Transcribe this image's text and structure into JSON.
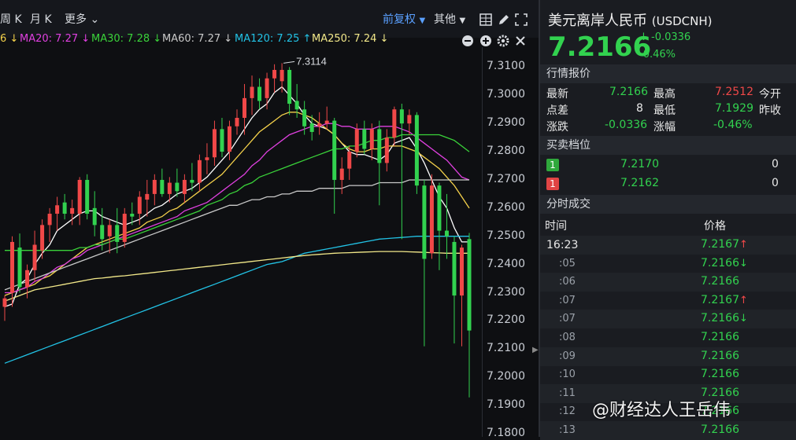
{
  "toolbar": {
    "period_week": "周 K",
    "period_month": "月 K",
    "more": "更多",
    "adjust": "前复权",
    "other": "其他"
  },
  "ma_legend": [
    {
      "text": "6 ↓",
      "color": "#f5d24b"
    },
    {
      "text": "MA20: 7.27 ↓",
      "color": "#e040e0"
    },
    {
      "text": "MA30: 7.28 ↓",
      "color": "#3ad33a"
    },
    {
      "text": "MA60: 7.27 ↓",
      "color": "#c9c9c9"
    },
    {
      "text": "MA120: 7.25 ↑",
      "color": "#22c3e6"
    },
    {
      "text": "MA250: 7.24 ↓",
      "color": "#f3e98a"
    }
  ],
  "chart_data": {
    "type": "candlestick",
    "annotation_high": "7.3114",
    "y_ticks": [
      "7.3100",
      "7.3000",
      "7.2900",
      "7.2800",
      "7.2700",
      "7.2600",
      "7.2500",
      "7.2400",
      "7.2300",
      "7.2200",
      "7.2100",
      "7.2000",
      "7.1900",
      "7.1800"
    ],
    "ylim": [
      7.18,
      7.3115
    ],
    "up_color": "#f04848",
    "down_color": "#32d24f",
    "candles": [
      {
        "o": 7.225,
        "h": 7.229,
        "l": 7.22,
        "c": 7.228
      },
      {
        "o": 7.23,
        "h": 7.25,
        "l": 7.225,
        "c": 7.248
      },
      {
        "o": 7.246,
        "h": 7.251,
        "l": 7.23,
        "c": 7.232
      },
      {
        "o": 7.232,
        "h": 7.24,
        "l": 7.228,
        "c": 7.238
      },
      {
        "o": 7.238,
        "h": 7.252,
        "l": 7.234,
        "c": 7.247
      },
      {
        "o": 7.245,
        "h": 7.256,
        "l": 7.242,
        "c": 7.254
      },
      {
        "o": 7.254,
        "h": 7.26,
        "l": 7.248,
        "c": 7.258
      },
      {
        "o": 7.258,
        "h": 7.264,
        "l": 7.252,
        "c": 7.261
      },
      {
        "o": 7.262,
        "h": 7.265,
        "l": 7.256,
        "c": 7.258
      },
      {
        "o": 7.258,
        "h": 7.263,
        "l": 7.254,
        "c": 7.26
      },
      {
        "o": 7.258,
        "h": 7.271,
        "l": 7.254,
        "c": 7.27
      },
      {
        "o": 7.27,
        "h": 7.272,
        "l": 7.256,
        "c": 7.258
      },
      {
        "o": 7.26,
        "h": 7.266,
        "l": 7.25,
        "c": 7.254
      },
      {
        "o": 7.254,
        "h": 7.26,
        "l": 7.245,
        "c": 7.249
      },
      {
        "o": 7.25,
        "h": 7.256,
        "l": 7.244,
        "c": 7.254
      },
      {
        "o": 7.254,
        "h": 7.26,
        "l": 7.244,
        "c": 7.248
      },
      {
        "o": 7.248,
        "h": 7.26,
        "l": 7.246,
        "c": 7.258
      },
      {
        "o": 7.258,
        "h": 7.262,
        "l": 7.254,
        "c": 7.257
      },
      {
        "o": 7.258,
        "h": 7.266,
        "l": 7.254,
        "c": 7.264
      },
      {
        "o": 7.263,
        "h": 7.27,
        "l": 7.257,
        "c": 7.265
      },
      {
        "o": 7.265,
        "h": 7.272,
        "l": 7.261,
        "c": 7.27
      },
      {
        "o": 7.27,
        "h": 7.274,
        "l": 7.264,
        "c": 7.265
      },
      {
        "o": 7.265,
        "h": 7.271,
        "l": 7.262,
        "c": 7.269
      },
      {
        "o": 7.269,
        "h": 7.274,
        "l": 7.264,
        "c": 7.266
      },
      {
        "o": 7.265,
        "h": 7.272,
        "l": 7.262,
        "c": 7.27
      },
      {
        "o": 7.27,
        "h": 7.276,
        "l": 7.266,
        "c": 7.269
      },
      {
        "o": 7.269,
        "h": 7.279,
        "l": 7.266,
        "c": 7.277
      },
      {
        "o": 7.277,
        "h": 7.283,
        "l": 7.272,
        "c": 7.278
      },
      {
        "o": 7.278,
        "h": 7.291,
        "l": 7.275,
        "c": 7.288
      },
      {
        "o": 7.288,
        "h": 7.292,
        "l": 7.278,
        "c": 7.28
      },
      {
        "o": 7.28,
        "h": 7.291,
        "l": 7.277,
        "c": 7.289
      },
      {
        "o": 7.289,
        "h": 7.295,
        "l": 7.286,
        "c": 7.292
      },
      {
        "o": 7.292,
        "h": 7.304,
        "l": 7.286,
        "c": 7.299
      },
      {
        "o": 7.299,
        "h": 7.307,
        "l": 7.293,
        "c": 7.303
      },
      {
        "o": 7.303,
        "h": 7.306,
        "l": 7.295,
        "c": 7.298
      },
      {
        "o": 7.299,
        "h": 7.308,
        "l": 7.295,
        "c": 7.306
      },
      {
        "o": 7.306,
        "h": 7.311,
        "l": 7.301,
        "c": 7.309
      },
      {
        "o": 7.305,
        "h": 7.3114,
        "l": 7.301,
        "c": 7.309
      },
      {
        "o": 7.309,
        "h": 7.31,
        "l": 7.293,
        "c": 7.297
      },
      {
        "o": 7.298,
        "h": 7.304,
        "l": 7.292,
        "c": 7.295
      },
      {
        "o": 7.295,
        "h": 7.298,
        "l": 7.286,
        "c": 7.289
      },
      {
        "o": 7.29,
        "h": 7.293,
        "l": 7.284,
        "c": 7.287
      },
      {
        "o": 7.289,
        "h": 7.294,
        "l": 7.286,
        "c": 7.29
      },
      {
        "o": 7.29,
        "h": 7.296,
        "l": 7.288,
        "c": 7.291
      },
      {
        "o": 7.291,
        "h": 7.292,
        "l": 7.258,
        "c": 7.27
      },
      {
        "o": 7.27,
        "h": 7.278,
        "l": 7.265,
        "c": 7.274
      },
      {
        "o": 7.274,
        "h": 7.282,
        "l": 7.27,
        "c": 7.28
      },
      {
        "o": 7.28,
        "h": 7.29,
        "l": 7.278,
        "c": 7.288
      },
      {
        "o": 7.288,
        "h": 7.291,
        "l": 7.279,
        "c": 7.281
      },
      {
        "o": 7.281,
        "h": 7.29,
        "l": 7.277,
        "c": 7.288
      },
      {
        "o": 7.288,
        "h": 7.291,
        "l": 7.261,
        "c": 7.276
      },
      {
        "o": 7.276,
        "h": 7.288,
        "l": 7.273,
        "c": 7.285
      },
      {
        "o": 7.285,
        "h": 7.296,
        "l": 7.282,
        "c": 7.295
      },
      {
        "o": 7.295,
        "h": 7.297,
        "l": 7.249,
        "c": 7.29
      },
      {
        "o": 7.29,
        "h": 7.295,
        "l": 7.286,
        "c": 7.293
      },
      {
        "o": 7.293,
        "h": 7.294,
        "l": 7.265,
        "c": 7.268
      },
      {
        "o": 7.268,
        "h": 7.27,
        "l": 7.211,
        "c": 7.242
      },
      {
        "o": 7.244,
        "h": 7.272,
        "l": 7.242,
        "c": 7.268
      },
      {
        "o": 7.268,
        "h": 7.269,
        "l": 7.238,
        "c": 7.252
      },
      {
        "o": 7.252,
        "h": 7.265,
        "l": 7.242,
        "c": 7.25
      },
      {
        "o": 7.248,
        "h": 7.25,
        "l": 7.212,
        "c": 7.229
      },
      {
        "o": 7.229,
        "h": 7.247,
        "l": 7.211,
        "c": 7.246
      },
      {
        "o": 7.249,
        "h": 7.2512,
        "l": 7.1929,
        "c": 7.2166
      }
    ],
    "ma_series": [
      {
        "color": "#ffffff",
        "values": [
          7.225,
          7.226,
          7.233,
          7.235,
          7.24,
          7.244,
          7.247,
          7.252,
          7.254,
          7.256,
          7.258,
          7.259,
          7.259,
          7.257,
          7.256,
          7.255,
          7.254,
          7.255,
          7.256,
          7.258,
          7.26,
          7.261,
          7.263,
          7.265,
          7.266,
          7.267,
          7.269,
          7.271,
          7.274,
          7.277,
          7.28,
          7.284,
          7.288,
          7.292,
          7.295,
          7.297,
          7.301,
          7.303,
          7.3,
          7.297,
          7.293,
          7.29,
          7.289,
          7.288,
          7.286,
          7.283,
          7.28,
          7.279,
          7.279,
          7.278,
          7.277,
          7.279,
          7.283,
          7.284,
          7.285,
          7.281,
          7.276,
          7.27,
          7.264,
          7.26,
          7.253,
          7.248,
          7.248
        ]
      },
      {
        "color": "#f5d24b",
        "values": [
          7.229,
          7.23,
          7.231,
          7.232,
          7.233,
          7.235,
          7.236,
          7.238,
          7.24,
          7.242,
          7.244,
          7.246,
          7.247,
          7.248,
          7.249,
          7.25,
          7.251,
          7.252,
          7.253,
          7.255,
          7.256,
          7.257,
          7.259,
          7.26,
          7.262,
          7.264,
          7.266,
          7.268,
          7.27,
          7.272,
          7.275,
          7.278,
          7.281,
          7.284,
          7.287,
          7.289,
          7.291,
          7.293,
          7.294,
          7.294,
          7.293,
          7.292,
          7.29,
          7.288,
          7.286,
          7.283,
          7.281,
          7.28,
          7.28,
          7.281,
          7.281,
          7.282,
          7.282,
          7.282,
          7.281,
          7.28,
          7.278,
          7.276,
          7.274,
          7.271,
          7.268,
          7.264,
          7.26
        ]
      },
      {
        "color": "#e040e0",
        "values": [
          7.23,
          7.23,
          7.231,
          7.232,
          7.234,
          7.235,
          7.237,
          7.239,
          7.24,
          7.242,
          7.243,
          7.245,
          7.246,
          7.247,
          7.248,
          7.249,
          7.25,
          7.251,
          7.252,
          7.253,
          7.254,
          7.255,
          7.256,
          7.257,
          7.259,
          7.26,
          7.261,
          7.262,
          7.264,
          7.266,
          7.268,
          7.27,
          7.272,
          7.275,
          7.277,
          7.28,
          7.282,
          7.284,
          7.286,
          7.287,
          7.288,
          7.289,
          7.289,
          7.29,
          7.29,
          7.289,
          7.289,
          7.288,
          7.288,
          7.288,
          7.289,
          7.289,
          7.289,
          7.288,
          7.287,
          7.285,
          7.283,
          7.281,
          7.279,
          7.277,
          7.274,
          7.271,
          7.27
        ]
      },
      {
        "color": "#3ad33a",
        "values": [
          7.245,
          7.245,
          7.245,
          7.245,
          7.245,
          7.245,
          7.245,
          7.245,
          7.245,
          7.245,
          7.246,
          7.246,
          7.247,
          7.247,
          7.248,
          7.249,
          7.249,
          7.25,
          7.251,
          7.252,
          7.253,
          7.254,
          7.255,
          7.256,
          7.257,
          7.258,
          7.259,
          7.261,
          7.262,
          7.263,
          7.265,
          7.266,
          7.268,
          7.269,
          7.271,
          7.272,
          7.273,
          7.274,
          7.275,
          7.276,
          7.277,
          7.278,
          7.279,
          7.28,
          7.281,
          7.281,
          7.282,
          7.282,
          7.283,
          7.284,
          7.284,
          7.285,
          7.285,
          7.286,
          7.286,
          7.286,
          7.286,
          7.286,
          7.286,
          7.285,
          7.284,
          7.282,
          7.28
        ]
      },
      {
        "color": "#c9c9c9",
        "values": [
          7.231,
          7.232,
          7.233,
          7.234,
          7.235,
          7.236,
          7.237,
          7.238,
          7.239,
          7.24,
          7.241,
          7.242,
          7.243,
          7.244,
          7.245,
          7.246,
          7.247,
          7.248,
          7.249,
          7.25,
          7.251,
          7.252,
          7.253,
          7.254,
          7.255,
          7.256,
          7.257,
          7.258,
          7.259,
          7.26,
          7.261,
          7.261,
          7.262,
          7.263,
          7.263,
          7.264,
          7.264,
          7.265,
          7.265,
          7.266,
          7.266,
          7.266,
          7.267,
          7.267,
          7.267,
          7.267,
          7.268,
          7.268,
          7.268,
          7.268,
          7.269,
          7.269,
          7.269,
          7.269,
          7.27,
          7.27,
          7.27,
          7.27,
          7.27,
          7.27,
          7.27,
          7.27,
          7.27
        ]
      },
      {
        "color": "#22c3e6",
        "values": [
          7.205,
          7.206,
          7.207,
          7.208,
          7.209,
          7.21,
          7.211,
          7.212,
          7.213,
          7.214,
          7.215,
          7.216,
          7.217,
          7.218,
          7.219,
          7.22,
          7.221,
          7.222,
          7.223,
          7.224,
          7.225,
          7.226,
          7.227,
          7.228,
          7.229,
          7.23,
          7.231,
          7.232,
          7.233,
          7.234,
          7.235,
          7.236,
          7.237,
          7.238,
          7.239,
          7.24,
          7.2405,
          7.241,
          7.242,
          7.243,
          7.244,
          7.2445,
          7.245,
          7.2455,
          7.246,
          7.2465,
          7.247,
          7.2475,
          7.248,
          7.2485,
          7.249,
          7.2492,
          7.2494,
          7.2496,
          7.2498,
          7.25,
          7.25,
          7.25,
          7.25,
          7.25,
          7.25,
          7.25,
          7.25
        ]
      },
      {
        "color": "#f3e98a",
        "values": [
          7.227,
          7.228,
          7.229,
          7.23,
          7.231,
          7.2315,
          7.232,
          7.2325,
          7.233,
          7.2335,
          7.234,
          7.2345,
          7.235,
          7.2352,
          7.2355,
          7.2358,
          7.236,
          7.2363,
          7.2366,
          7.2369,
          7.2372,
          7.2375,
          7.2378,
          7.2381,
          7.2384,
          7.2387,
          7.239,
          7.2393,
          7.2396,
          7.2399,
          7.2402,
          7.2405,
          7.2408,
          7.2411,
          7.2414,
          7.2417,
          7.242,
          7.2423,
          7.2426,
          7.2429,
          7.2432,
          7.2434,
          7.2436,
          7.2438,
          7.244,
          7.2441,
          7.2442,
          7.2443,
          7.2444,
          7.2445,
          7.2446,
          7.2446,
          7.2446,
          7.2446,
          7.2445,
          7.2444,
          7.2443,
          7.2442,
          7.2441,
          7.244,
          7.244,
          7.244,
          7.244
        ]
      }
    ]
  },
  "quote": {
    "title": "美元离岸人民币",
    "code": "(USDCNH)",
    "price": "7.2166",
    "change": "↓ -0.0336",
    "change_pct": "-0.46%",
    "section_quote": "行情报价",
    "rows": {
      "latest_lbl": "最新",
      "latest_val": "7.2166",
      "high_lbl": "最高",
      "high_val": "7.2512",
      "open_lbl": "今开",
      "spread_lbl": "点差",
      "spread_val": "8",
      "low_lbl": "最低",
      "low_val": "7.1929",
      "prev_lbl": "昨收",
      "chg_lbl": "涨跌",
      "chg_val": "-0.0336",
      "pct_lbl": "涨幅",
      "pct_val": "-0.46%"
    },
    "section_book": "买卖档位",
    "book": [
      {
        "badge": "1",
        "badge_color": "#2fa83c",
        "price": "7.2170",
        "qty": "0"
      },
      {
        "badge": "1",
        "badge_color": "#e04444",
        "price": "7.2162",
        "qty": "0"
      }
    ],
    "section_ticks": "分时成交",
    "tick_head_time": "时间",
    "tick_head_price": "价格",
    "ticks": [
      {
        "time": "16:23",
        "price": "7.2167",
        "arrow": "↑"
      },
      {
        "time": ":05",
        "price": "7.2166",
        "arrow": "↓"
      },
      {
        "time": ":06",
        "price": "7.2166",
        "arrow": ""
      },
      {
        "time": ":07",
        "price": "7.2167",
        "arrow": "↑"
      },
      {
        "time": ":07",
        "price": "7.2166",
        "arrow": "↓"
      },
      {
        "time": ":08",
        "price": "7.2166",
        "arrow": ""
      },
      {
        "time": ":09",
        "price": "7.2166",
        "arrow": ""
      },
      {
        "time": ":10",
        "price": "7.2166",
        "arrow": ""
      },
      {
        "time": ":11",
        "price": "7.2166",
        "arrow": ""
      },
      {
        "time": ":12",
        "price": "7.2166",
        "arrow": ""
      },
      {
        "time": ":13",
        "price": "7.2166",
        "arrow": ""
      }
    ]
  },
  "watermark": "@财经达人王岳伟"
}
